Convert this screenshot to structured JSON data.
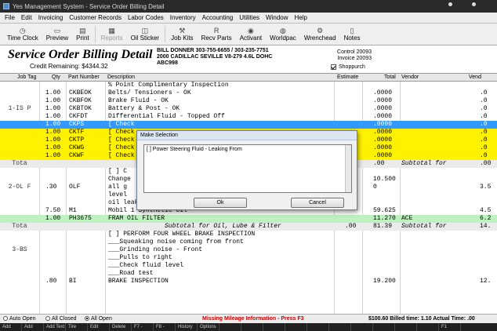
{
  "window": {
    "title": "Yes Management System - Service Order Billing Detail"
  },
  "menu": [
    "File",
    "Edit",
    "Invoicing",
    "Customer Records",
    "Labor Codes",
    "Inventory",
    "Accounting",
    "Utilities",
    "Window",
    "Help"
  ],
  "toolbar": [
    {
      "label": "Time Clock",
      "icon": "clock-icon",
      "glyph": "◷",
      "enabled": true
    },
    {
      "label": "Preview",
      "icon": "preview-icon",
      "glyph": "▭",
      "enabled": true
    },
    {
      "label": "Print",
      "icon": "printer-icon",
      "glyph": "▤",
      "enabled": true
    },
    {
      "label": "Reports",
      "icon": "reports-icon",
      "glyph": "▦",
      "enabled": false
    },
    {
      "label": "Oil Sticker",
      "icon": "sticker-icon",
      "glyph": "◫",
      "enabled": true
    },
    {
      "label": "Job Kits",
      "icon": "tools-icon",
      "glyph": "⚒",
      "enabled": true
    },
    {
      "label": "Recv Parts",
      "icon": "receive-parts-icon",
      "glyph": "R",
      "enabled": true
    },
    {
      "label": "Activant",
      "icon": "activant-icon",
      "glyph": "◉",
      "enabled": true
    },
    {
      "label": "Worldpac",
      "icon": "worldpac-icon",
      "glyph": "◍",
      "enabled": true
    },
    {
      "label": "Wrenchead",
      "icon": "wrench-icon",
      "glyph": "⚙",
      "enabled": true
    },
    {
      "label": "Notes",
      "icon": "notes-icon",
      "glyph": "▯",
      "enabled": true
    }
  ],
  "header": {
    "title": "Service Order Billing Detail",
    "credit_remaining": "Credit Remaining: $4344.32",
    "customer_line": "BILL DONNER  303-755-6655 / 303-235-7751",
    "vehicle_line": "2000 CADILLAC SEVILLE V8-279  4.6L DOHC",
    "plate_line": "ABC998",
    "control": "Control 20093",
    "invoice": "Invoice 20093",
    "shop_purchase": "Shoppurch"
  },
  "columns": [
    "Job Tag",
    "Qty",
    "Part Number",
    "Description",
    "Estimate",
    "Total",
    "Vendor",
    "Vend"
  ],
  "grid": [
    {
      "style": "",
      "qty": "",
      "part": "",
      "desc": "% Point Complimentary Inspection",
      "est": "",
      "total": "",
      "vendor": "",
      "vend": ""
    },
    {
      "style": "",
      "qty": "1.00",
      "part": "CKBEOK",
      "desc": "Belts/ Tensioners - OK",
      "est": "",
      "total": ".0000",
      "vendor": "",
      "vend": ".0"
    },
    {
      "style": "",
      "qty": "1.00",
      "part": "CKBFOK",
      "desc": "Brake Fluid - OK",
      "est": "",
      "total": ".0000",
      "vendor": "",
      "vend": ".0"
    },
    {
      "style": "",
      "qty": "1.00",
      "part": "CKBTOK",
      "desc": "Battery & Post - OK",
      "est": "",
      "total": ".0000",
      "vendor": "",
      "vend": ".0"
    },
    {
      "style": "",
      "qty": "1.00",
      "part": "CKFDT",
      "desc": "Differential Fluid - Topped Off",
      "est": "",
      "total": ".0000",
      "vendor": "",
      "vend": ".0"
    },
    {
      "style": "blue",
      "qty": "1.00",
      "part": "CKPS",
      "desc": "[ Check",
      "est": "",
      "total": ".0000",
      "vendor": "",
      "vend": ".0"
    },
    {
      "style": "yellow",
      "qty": "1.00",
      "part": "CKTF",
      "desc": "[ Check",
      "est": "",
      "total": ".0000",
      "vendor": "",
      "vend": ".0"
    },
    {
      "style": "yellow",
      "qty": "1.00",
      "part": "CKTP",
      "desc": "[ Check",
      "est": "",
      "total": ".0000",
      "vendor": "",
      "vend": ".0"
    },
    {
      "style": "yellow",
      "qty": "1.00",
      "part": "CKWG",
      "desc": "[ Check",
      "est": "",
      "total": ".0000",
      "vendor": "",
      "vend": ".0"
    },
    {
      "style": "yellow",
      "qty": "1.00",
      "part": "CKWF",
      "desc": "[ Check",
      "est": "",
      "total": ".0000",
      "vendor": "",
      "vend": ".0"
    },
    {
      "style": "gray",
      "qty": "",
      "part": "",
      "desc": "",
      "est": "",
      "total": ".00",
      "vendor": "Subtotal for",
      "vend": ".00"
    },
    {
      "style": "",
      "qty": "",
      "part": "",
      "desc": "[ ] C",
      "est": "",
      "total": "",
      "vendor": "",
      "vend": ""
    },
    {
      "style": "",
      "qty": "",
      "part": "",
      "desc": "Change",
      "est": "",
      "total": "10.500",
      "vendor": "",
      "vend": ""
    },
    {
      "style": "",
      "qty": ".30",
      "part": "OLF",
      "desc": "all g",
      "est": "",
      "total": "0",
      "vendor": "",
      "vend": "3.5"
    },
    {
      "style": "",
      "qty": "",
      "part": "",
      "desc": "level",
      "est": "",
      "total": "",
      "vendor": "",
      "vend": ""
    },
    {
      "style": "",
      "qty": "",
      "part": "",
      "desc": "oil leaks and inspect undercarriage.",
      "est": "",
      "total": "",
      "vendor": "",
      "vend": ""
    },
    {
      "style": "",
      "qty": "7.50",
      "part": "M1",
      "desc": "Mobil 1 Synthetic Oil",
      "est": "",
      "total": "59.625",
      "vendor": "",
      "vend": "4.5"
    },
    {
      "style": "green",
      "qty": "1.00",
      "part": "PH3675",
      "desc": "FRAM OIL FILTER",
      "est": "",
      "total": "11.270",
      "vendor": "ACE",
      "vend": "6.2"
    },
    {
      "style": "gray",
      "qty": "",
      "part": "",
      "desc": "Subtotal for Oil, Lube & Filter",
      "est": ".00",
      "total": "81.39",
      "vendor": "Subtotal for",
      "vend": "14."
    },
    {
      "style": "",
      "qty": "",
      "part": "",
      "desc": "[ ] PERFORM FOUR WHEEL BRAKE INSPECTION",
      "est": "",
      "total": "",
      "vendor": "",
      "vend": ""
    },
    {
      "style": "",
      "qty": "",
      "part": "",
      "desc": "___Squeaking noise coming from front",
      "est": "",
      "total": "",
      "vendor": "",
      "vend": ""
    },
    {
      "style": "",
      "qty": "",
      "part": "",
      "desc": "___Grinding noise - Front",
      "est": "",
      "total": "",
      "vendor": "",
      "vend": ""
    },
    {
      "style": "",
      "qty": "",
      "part": "",
      "desc": "___Pulls to right",
      "est": "",
      "total": "",
      "vendor": "",
      "vend": ""
    },
    {
      "style": "",
      "qty": "",
      "part": "",
      "desc": "___Check fluid level",
      "est": "",
      "total": "",
      "vendor": "",
      "vend": ""
    },
    {
      "style": "",
      "qty": "",
      "part": "",
      "desc": "___Road test",
      "est": "",
      "total": "",
      "vendor": "",
      "vend": ""
    },
    {
      "style": "",
      "qty": ".80",
      "part": "BI",
      "desc": "BRAKE INSPECTION",
      "est": "",
      "total": "19.200",
      "vendor": "",
      "vend": "12."
    }
  ],
  "job_tags": [
    {
      "label": "1-IS P",
      "row": 3
    },
    {
      "label": "Tota",
      "row": 10
    },
    {
      "label": "2-OL F",
      "row": 13
    },
    {
      "label": "Tota",
      "row": 18
    },
    {
      "label": "3-BS",
      "row": 21
    }
  ],
  "dialog": {
    "title": "Make Selection",
    "item": "[ ] Power Steering Fluid - Leaking From",
    "ok": "Ok",
    "cancel": "Cancel"
  },
  "status": {
    "auto_open": "Auto Open",
    "all_closed": "All Closed",
    "all_open": "All Open",
    "warning": "Missing Mileage Information - Press F3",
    "billed": "$100.60 Billed time: 1.10 Actual Time: .00"
  },
  "keys": [
    "Add Labor",
    "Add Parts",
    "Add Text",
    "Tire Guide",
    "Edit",
    "Delete",
    "F7 - Totals",
    "F8 - Detail",
    "History",
    "Options",
    "",
    "",
    "",
    "",
    "",
    "",
    "",
    "",
    "",
    "",
    "F1"
  ],
  "colors": {
    "selected": "#3399ff",
    "highlight": "#fff200",
    "part_row": "#bff0bf",
    "warning_text": "#cc0000"
  }
}
